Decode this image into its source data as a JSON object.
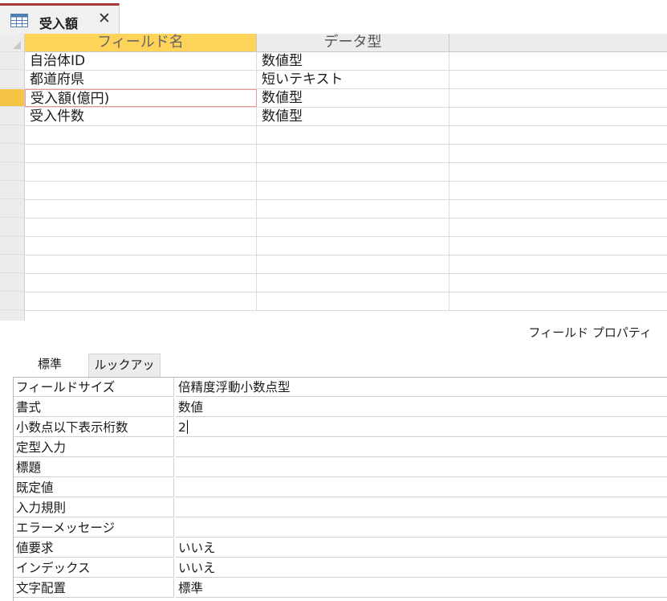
{
  "tab": {
    "title": "受入額",
    "close": "✕",
    "icon": "table-icon"
  },
  "grid": {
    "headers": [
      "フィールド名",
      "データ型"
    ],
    "rows": [
      {
        "name": "自治体ID",
        "type": "数値型"
      },
      {
        "name": "都道府県",
        "type": "短いテキスト"
      },
      {
        "name": "受入額(億円)",
        "type": "数値型"
      },
      {
        "name": "受入件数",
        "type": "数値型"
      }
    ]
  },
  "properties": {
    "title": "フィールド プロパティ",
    "tabs": [
      "標準",
      "ルックアップ"
    ],
    "rows": [
      {
        "name": "フィールドサイズ",
        "value": "倍精度浮動小数点型"
      },
      {
        "name": "書式",
        "value": "数値"
      },
      {
        "name": "小数点以下表示桁数",
        "value": "2"
      },
      {
        "name": "定型入力",
        "value": ""
      },
      {
        "name": "標題",
        "value": ""
      },
      {
        "name": "既定値",
        "value": ""
      },
      {
        "name": "入力規則",
        "value": ""
      },
      {
        "name": "エラーメッセージ",
        "value": ""
      },
      {
        "name": "値要求",
        "value": "いいえ"
      },
      {
        "name": "インデックス",
        "value": "いいえ"
      },
      {
        "name": "文字配置",
        "value": "標準"
      }
    ]
  },
  "colors": {
    "accent": "#a4373a",
    "selected_row": "#f5c344",
    "active_header": "#fed35a"
  }
}
